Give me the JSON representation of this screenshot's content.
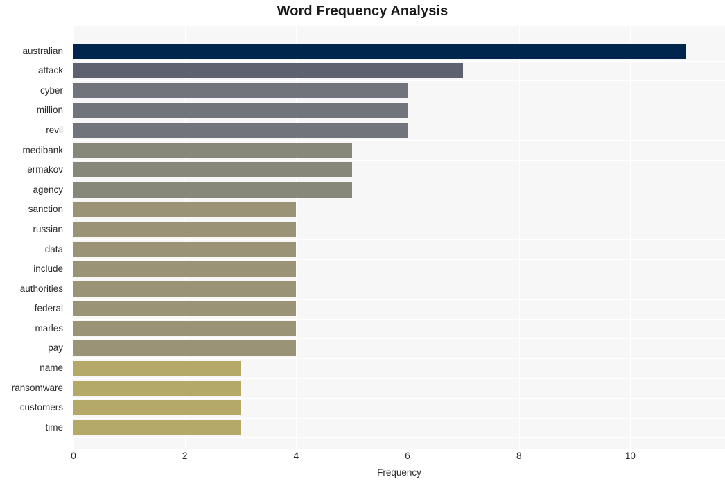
{
  "chart_data": {
    "type": "bar",
    "orientation": "horizontal",
    "title": "Word Frequency Analysis",
    "xlabel": "Frequency",
    "ylabel": "",
    "categories": [
      "australian",
      "attack",
      "cyber",
      "million",
      "revil",
      "medibank",
      "ermakov",
      "agency",
      "sanction",
      "russian",
      "data",
      "include",
      "authorities",
      "federal",
      "marles",
      "pay",
      "name",
      "ransomware",
      "customers",
      "time"
    ],
    "values": [
      11,
      7,
      6,
      6,
      6,
      5,
      5,
      5,
      4,
      4,
      4,
      4,
      4,
      4,
      4,
      4,
      3,
      3,
      3,
      3
    ],
    "bar_colors": [
      "#00264d",
      "#5d6170",
      "#71747a",
      "#71747a",
      "#71747a",
      "#87887a",
      "#87887a",
      "#87887a",
      "#9b9375",
      "#9b9375",
      "#9b9375",
      "#9b9375",
      "#9b9375",
      "#9b9375",
      "#9b9375",
      "#9b9375",
      "#b5a96a",
      "#b5a96a",
      "#b5a96a",
      "#b5a96a"
    ],
    "xlim": [
      0,
      11.7
    ],
    "xticks": [
      0,
      2,
      4,
      6,
      8,
      10
    ],
    "xticklabels": [
      "0",
      "2",
      "4",
      "6",
      "8",
      "10"
    ],
    "grid": true,
    "grid_color": "#ffffff",
    "plot_background": "#f7f7f7",
    "figure_background": "#ffffff",
    "legend": null,
    "title_color": "#1a1a1a",
    "tick_label_color": "#2b2b2b"
  }
}
